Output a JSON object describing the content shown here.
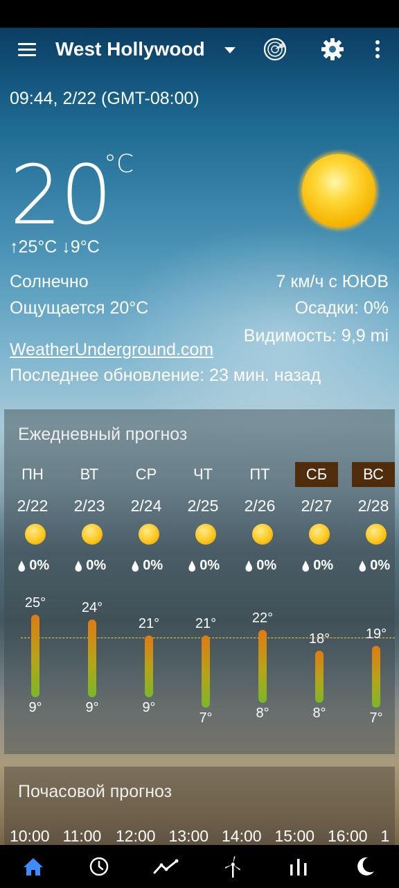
{
  "header": {
    "city": "West Hollywood"
  },
  "current": {
    "datetime": "09:44, 2/22 (GMT-08:00)",
    "temperature": "20",
    "unit": "°C",
    "high_low": "↑25°C ↓9°C",
    "condition": "Солнечно",
    "feels_like": "Ощущается 20°C",
    "wind": "7 км/ч с ЮЮВ",
    "precipitation": "Осадки: 0%",
    "visibility": "Видимость: 9,9 mi",
    "source": "WeatherUnderground.com",
    "updated": "Последнее обновление: 23 мин. назад"
  },
  "daily": {
    "title": "Ежедневный прогноз",
    "days": [
      {
        "day": "ПН",
        "date": "2/22",
        "rain": "0%",
        "hi": "25°",
        "lo": "9°",
        "hi_val": 25,
        "lo_val": 9,
        "weekend": false
      },
      {
        "day": "ВТ",
        "date": "2/23",
        "rain": "0%",
        "hi": "24°",
        "lo": "9°",
        "hi_val": 24,
        "lo_val": 9,
        "weekend": false
      },
      {
        "day": "СР",
        "date": "2/24",
        "rain": "0%",
        "hi": "21°",
        "lo": "9°",
        "hi_val": 21,
        "lo_val": 9,
        "weekend": false
      },
      {
        "day": "ЧТ",
        "date": "2/25",
        "rain": "0%",
        "hi": "21°",
        "lo": "7°",
        "hi_val": 21,
        "lo_val": 7,
        "weekend": false
      },
      {
        "day": "ПТ",
        "date": "2/26",
        "rain": "0%",
        "hi": "22°",
        "lo": "8°",
        "hi_val": 22,
        "lo_val": 8,
        "weekend": false
      },
      {
        "day": "СБ",
        "date": "2/27",
        "rain": "0%",
        "hi": "18°",
        "lo": "8°",
        "hi_val": 18,
        "lo_val": 8,
        "weekend": true
      },
      {
        "day": "ВС",
        "date": "2/28",
        "rain": "0%",
        "hi": "19°",
        "lo": "7°",
        "hi_val": 19,
        "lo_val": 7,
        "weekend": true
      }
    ]
  },
  "hourly": {
    "title": "Почасовой прогноз",
    "hours": [
      "10:00",
      "11:00",
      "12:00",
      "13:00",
      "14:00",
      "15:00",
      "16:00",
      "1"
    ]
  },
  "nav": [
    "home-icon",
    "clock-icon",
    "trend-icon",
    "wind-turbine-icon",
    "bars-icon",
    "moon-icon"
  ],
  "colors": {
    "accent_active": "#3d8bff",
    "weekend_tab": "#4e2c0c",
    "avg_line": "#f0d23a"
  }
}
